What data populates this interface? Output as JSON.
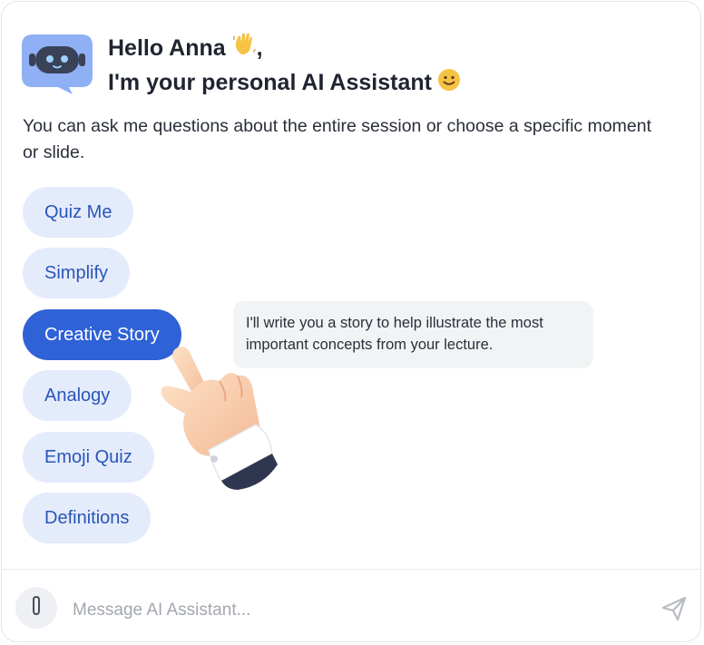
{
  "greeting": {
    "line1": "Hello Anna",
    "line1_suffix": ",",
    "line2": "I'm your personal AI Assistant",
    "wave_icon": "waving-hand-emoji",
    "smile_icon": "slightly-smiling-face-emoji"
  },
  "intro": "You can ask me questions about the entire session or choose a specific moment or slide.",
  "actions": [
    {
      "label": "Quiz Me",
      "active": false
    },
    {
      "label": "Simplify",
      "active": false
    },
    {
      "label": "Creative Story",
      "active": true
    },
    {
      "label": "Analogy",
      "active": false
    },
    {
      "label": "Emoji Quiz",
      "active": false
    },
    {
      "label": "Definitions",
      "active": false
    }
  ],
  "tooltip": {
    "text": "I'll write you a story to help illustrate the most important concepts from your lecture."
  },
  "composer": {
    "placeholder": "Message AI Assistant...",
    "attach_icon": "paperclip-icon",
    "send_icon": "send-icon"
  },
  "colors": {
    "accent": "#2f62d6",
    "chip_bg": "#e4ebfb",
    "chip_text": "#2a56b8",
    "avatar_bg": "#8fb0f5"
  }
}
